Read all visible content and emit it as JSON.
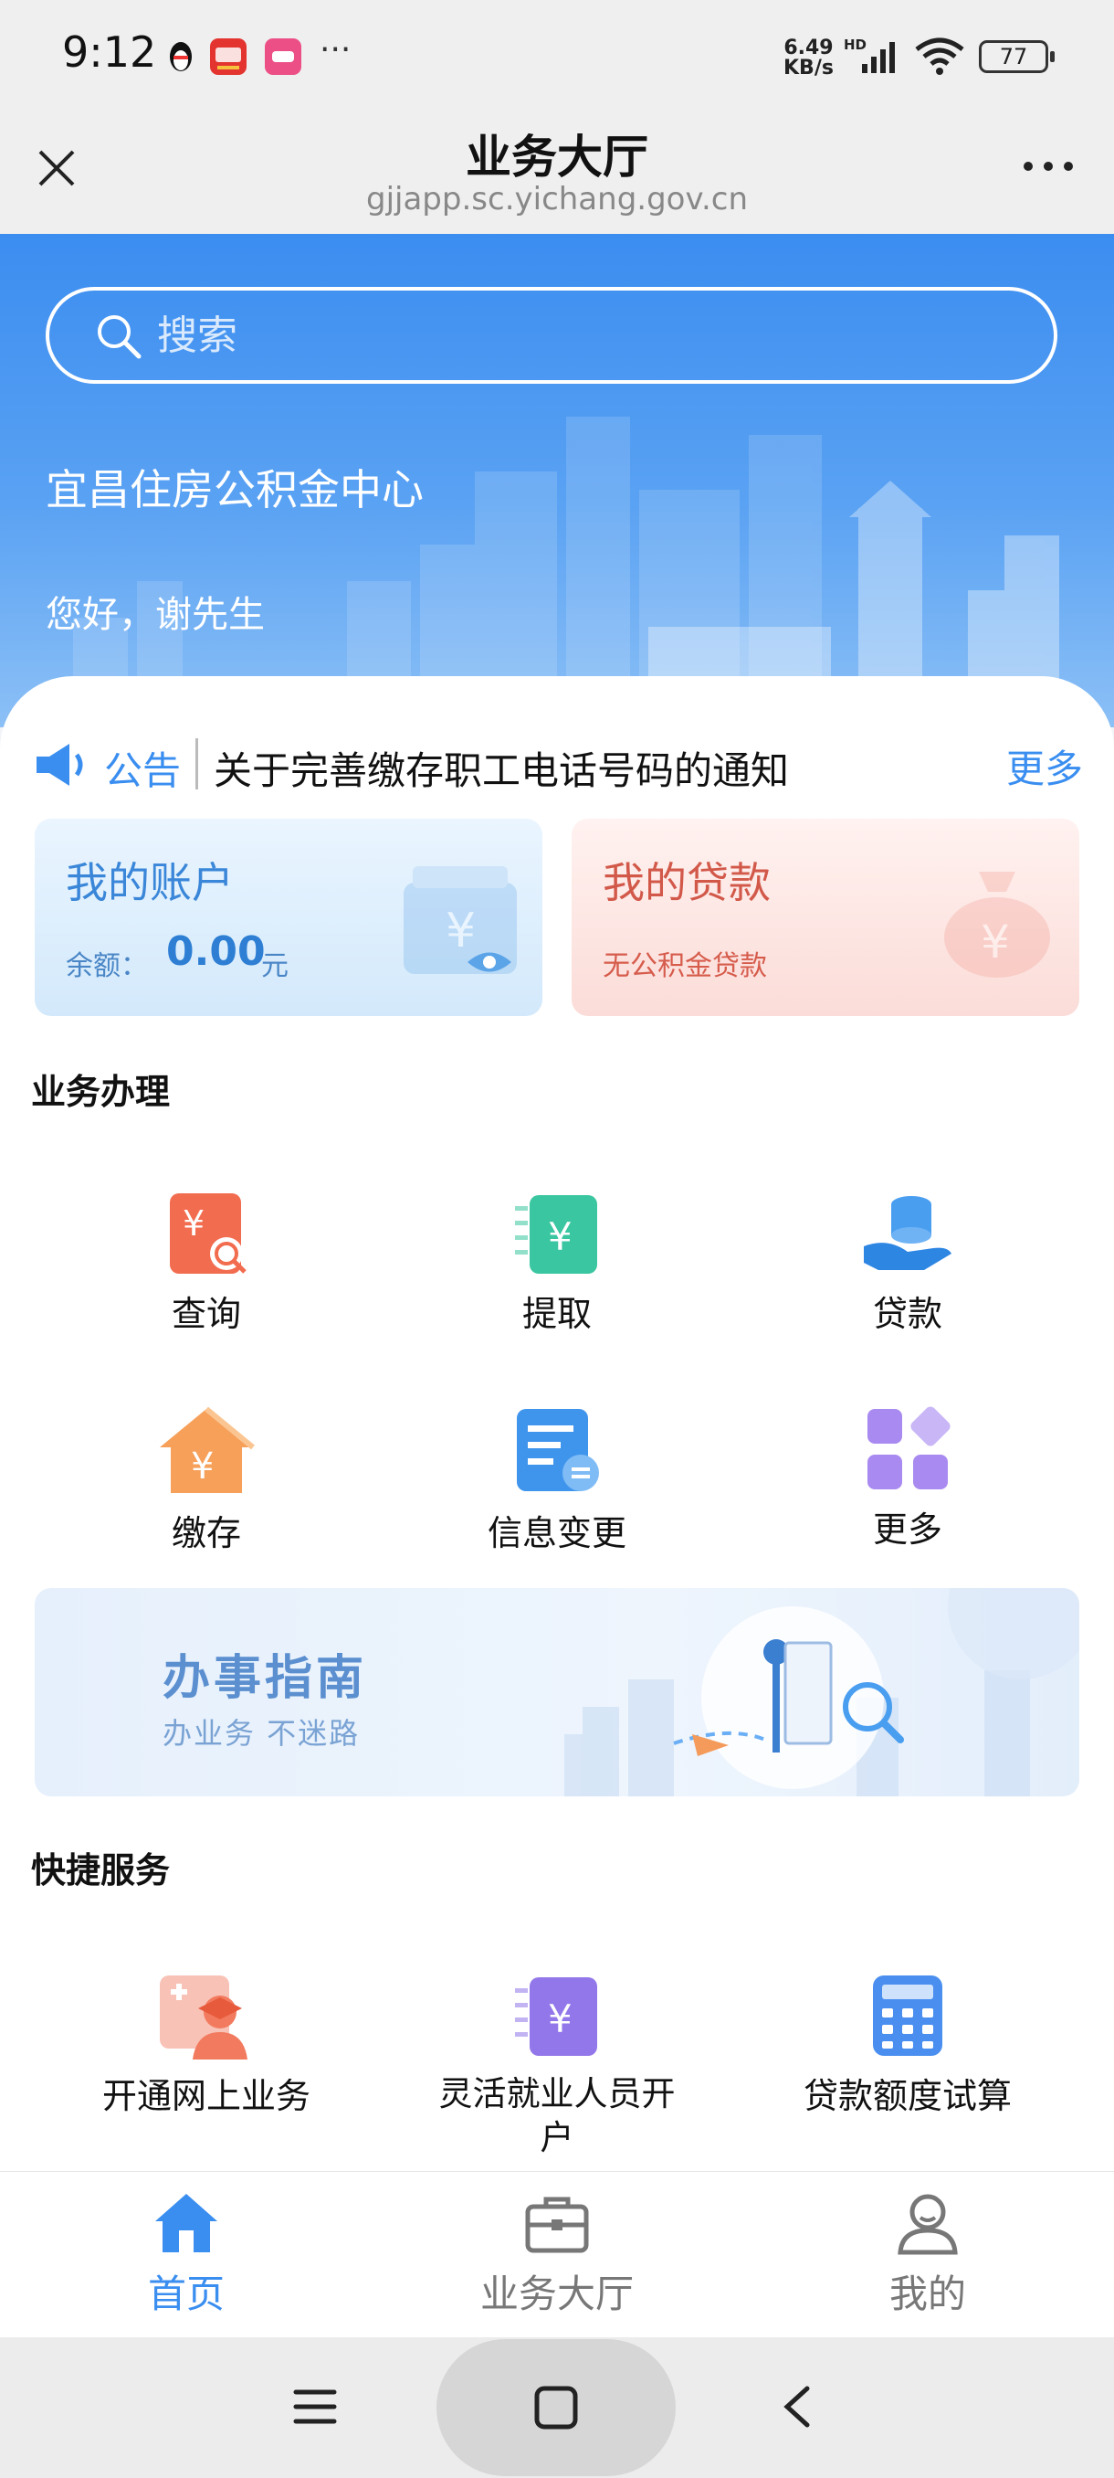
{
  "status_bar": {
    "time": "9:12",
    "overflow": "···",
    "net_speed_top": "6.49",
    "net_speed_bottom": "KB/s",
    "network_badge": "HD",
    "battery": "77",
    "app_icons": [
      "qq-penguin-icon",
      "toutiao-app-icon",
      "pink-app-icon"
    ]
  },
  "title_bar": {
    "title": "业务大厅",
    "url": "gjjapp.sc.yichang.gov.cn"
  },
  "hero": {
    "search_placeholder": "搜索",
    "org_name": "宜昌住房公积金中心",
    "greeting": "您好，谢先生"
  },
  "notice": {
    "tag": "公告",
    "text": "关于完善缴存职工电话号码的通知",
    "more": "更多"
  },
  "account_card": {
    "title": "我的账户",
    "balance_label": "余额：",
    "balance_value": "0.00",
    "balance_unit": "元"
  },
  "loan_card": {
    "title": "我的贷款",
    "status": "无公积金贷款"
  },
  "business": {
    "title": "业务办理",
    "items": [
      {
        "label": "查询",
        "icon": "query-icon"
      },
      {
        "label": "提取",
        "icon": "withdraw-icon"
      },
      {
        "label": "贷款",
        "icon": "loan-icon"
      },
      {
        "label": "缴存",
        "icon": "deposit-icon"
      },
      {
        "label": "信息变更",
        "icon": "info-change-icon"
      },
      {
        "label": "更多",
        "icon": "more-grid-icon"
      }
    ]
  },
  "guide_banner": {
    "title": "办事指南",
    "subtitle": "办业务 不迷路"
  },
  "quick": {
    "title": "快捷服务",
    "items": [
      {
        "label": "开通网上业务",
        "icon": "open-online-icon"
      },
      {
        "label": "灵活就业人员开户",
        "icon": "flexible-account-icon"
      },
      {
        "label": "贷款额度试算",
        "icon": "calculator-icon"
      }
    ]
  },
  "bottom_nav": {
    "items": [
      {
        "label": "首页",
        "icon": "home-icon",
        "active": true
      },
      {
        "label": "业务大厅",
        "icon": "briefcase-icon",
        "active": false
      },
      {
        "label": "我的",
        "icon": "user-icon",
        "active": false
      }
    ]
  },
  "colors": {
    "accent": "#3a8ef0",
    "hero_top": "#3b8df0",
    "loan_red": "#d2594a",
    "inactive_nav": "#777777"
  }
}
